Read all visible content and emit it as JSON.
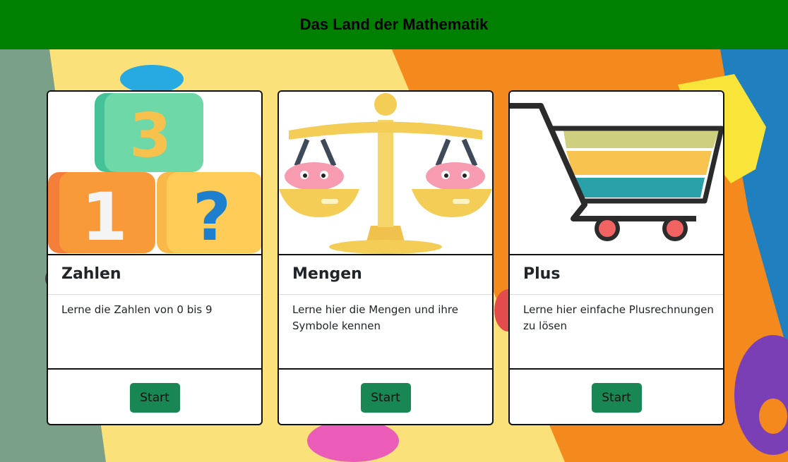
{
  "header": {
    "title": "Das Land der Mathematik"
  },
  "colors": {
    "header": "#008000",
    "button": "#198754"
  },
  "cards": [
    {
      "title": "Zahlen",
      "text": "Lerne die Zahlen von 0 bis 9",
      "button": "Start",
      "icon": "number-blocks-image",
      "image_glyphs": [
        "3",
        "1",
        "?"
      ]
    },
    {
      "title": "Mengen",
      "text": "Lerne hier die Mengen und ihre Symbole kennen",
      "button": "Start",
      "icon": "balance-scale-image"
    },
    {
      "title": "Plus",
      "text": "Lerne hier einfache Plusrechnungen zu lösen",
      "button": "Start",
      "icon": "shopping-cart-image"
    }
  ]
}
